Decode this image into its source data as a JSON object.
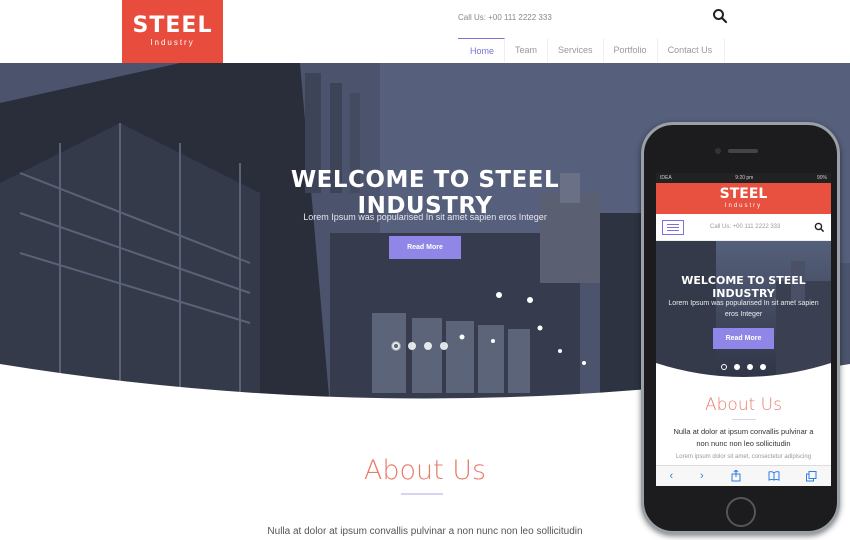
{
  "header": {
    "logo_title": "STEEL",
    "logo_subtitle": "Industry",
    "call_us": "Call Us: +00 111 2222 333",
    "nav": [
      "Home",
      "Team",
      "Services",
      "Portfolio",
      "Contact Us"
    ],
    "active_nav": "Home",
    "accent_color": "#e84c3d",
    "nav_active_color": "#7b71d6"
  },
  "hero": {
    "title": "WELCOME TO STEEL INDUSTRY",
    "subtitle": "Lorem Ipsum was popularised In sit amet sapien eros Integer",
    "button": "Read More",
    "slides": 4,
    "active_slide": 1
  },
  "about": {
    "title": "About Us",
    "text": "Nulla at dolor at ipsum convallis pulvinar a non nunc non leo sollicitudin"
  },
  "phone": {
    "carrier": "IDEA",
    "time": "9:20 pm",
    "battery": "90%",
    "logo_title": "STEEL",
    "logo_subtitle": "Industry",
    "call_us": "Call Us: +00 111 2222 333",
    "hero_title": "WELCOME TO STEEL INDUSTRY",
    "hero_subtitle": "Lorem Ipsum was popularised In sit amet sapien eros Integer",
    "button": "Read More",
    "about_title": "About Us",
    "about_text": "Nulla at dolor at ipsum convallis pulvinar a non nunc non leo sollicitudin",
    "about_text2": "Lorem ipsum dolor sit amet, consectetur adipiscing",
    "toolbar_icons": [
      "back-icon",
      "forward-icon",
      "share-icon",
      "bookmarks-icon",
      "tabs-icon"
    ]
  }
}
